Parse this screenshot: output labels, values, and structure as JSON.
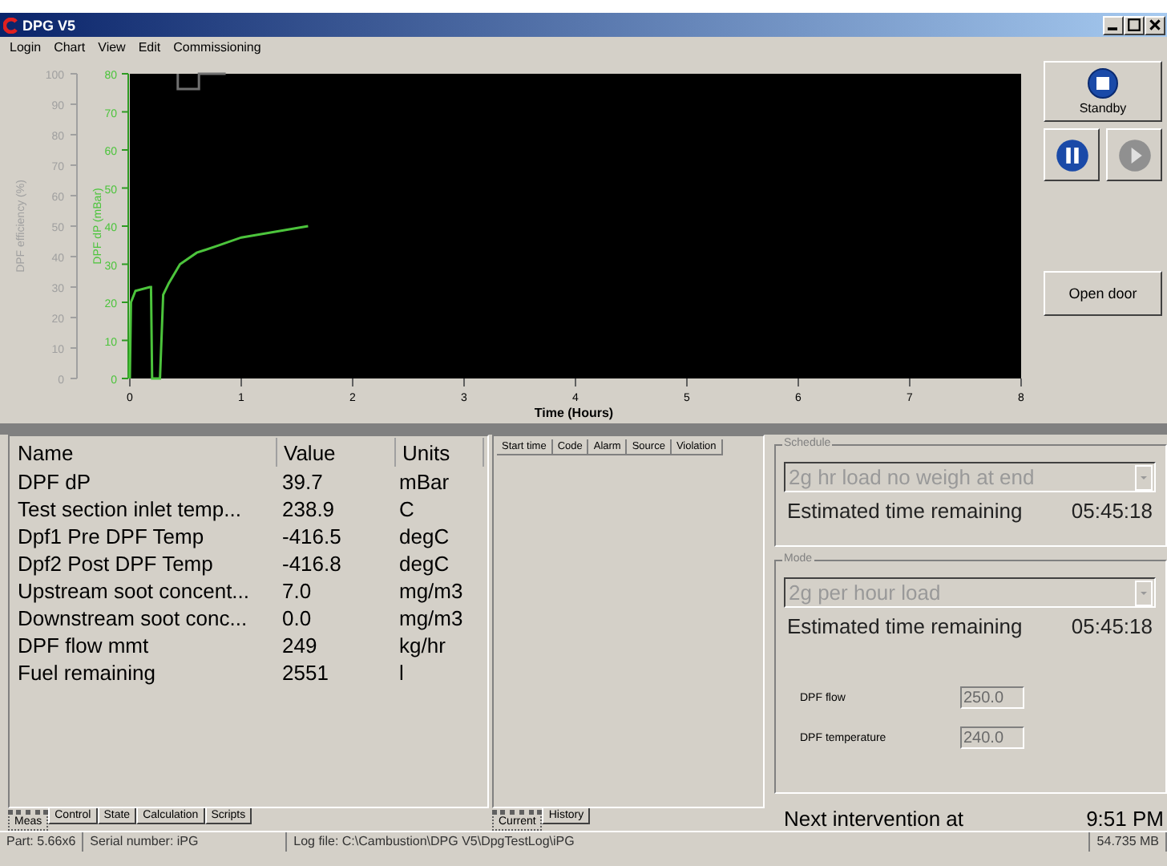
{
  "window": {
    "title": "DPG V5"
  },
  "menu": [
    "Login",
    "Chart",
    "View",
    "Edit",
    "Commissioning"
  ],
  "chart": {
    "chart_data": {
      "type": "line",
      "xlabel": "Time (Hours)",
      "ylabel": "DPF dP (mBar)",
      "y2label": "DPF efficiency (%)",
      "xlim": [
        0,
        8
      ],
      "ylim": [
        0,
        80
      ],
      "y2lim": [
        0,
        100
      ],
      "xticks": [
        0,
        1,
        2,
        3,
        4,
        5,
        6,
        7,
        8
      ],
      "yticks": [
        0,
        10,
        20,
        30,
        40,
        50,
        60,
        70,
        80
      ],
      "y2ticks": [
        0,
        10,
        20,
        30,
        40,
        50,
        60,
        70,
        80,
        90,
        100
      ],
      "series": [
        {
          "color": "#4cc43c",
          "axis": "y",
          "x": [
            0,
            0.01,
            0.05,
            0.18,
            0.19,
            0.2,
            0.27,
            0.3,
            0.35,
            0.45,
            0.6,
            0.8,
            1.0,
            1.2,
            1.4,
            1.6
          ],
          "values": [
            0,
            20,
            23,
            24,
            24,
            0,
            0,
            22,
            25,
            30,
            33,
            35,
            37,
            38,
            39,
            40
          ]
        },
        {
          "color": "#707070",
          "axis": "y2",
          "x": [
            0.43,
            0.43,
            0.62,
            0.62,
            0.86
          ],
          "values": [
            100,
            95,
            95,
            100,
            100
          ]
        }
      ]
    }
  },
  "controls": [
    {
      "kind": "stop",
      "label": "Standby",
      "disabled": false
    },
    {
      "kind": "pause",
      "disabled": false
    },
    {
      "kind": "play",
      "disabled": true
    },
    {
      "kind": "text",
      "label": "Open door",
      "disabled": false
    }
  ],
  "measurements": {
    "columns": [
      "Name",
      "Value",
      "Units"
    ],
    "rows": [
      [
        "DPF dP",
        "39.7",
        "mBar"
      ],
      [
        "Test section inlet temp...",
        "238.9",
        "C"
      ],
      [
        "Dpf1 Pre DPF  Temp",
        "-416.5",
        "degC"
      ],
      [
        "Dpf2 Post DPF Temp",
        "-416.8",
        "degC"
      ],
      [
        "Upstream soot concent...",
        "7.0",
        "mg/m3"
      ],
      [
        "Downstream soot conc...",
        "0.0",
        "mg/m3"
      ],
      [
        "DPF flow mmt",
        "249",
        "kg/hr"
      ],
      [
        "Fuel remaining",
        "2551",
        "l"
      ]
    ],
    "tabs": [
      {
        "label": "Meas",
        "selected": true
      },
      {
        "label": "Control",
        "selected": false
      },
      {
        "label": "State",
        "selected": false
      },
      {
        "label": "Calculation",
        "selected": false
      },
      {
        "label": "Scripts",
        "selected": false
      }
    ]
  },
  "alarms": {
    "columns": [
      "Start time",
      "Code",
      "Alarm",
      "Source",
      "Violation"
    ],
    "tabs": [
      {
        "label": "Current",
        "selected": true
      },
      {
        "label": "History",
        "selected": false
      }
    ]
  },
  "schedule": {
    "title": "Schedule",
    "value": "2g hr load no weigh at end",
    "disabled": true,
    "remaining_label": "Estimated time remaining",
    "remaining": "05:45:18"
  },
  "mode": {
    "title": "Mode",
    "value": "2g per hour load",
    "disabled": true,
    "remaining_label": "Estimated time remaining",
    "remaining": "05:45:18",
    "fields": [
      {
        "label": "DPF flow",
        "value": "250.0",
        "disabled": true
      },
      {
        "label": "DPF temperature",
        "value": "240.0",
        "disabled": true
      }
    ]
  },
  "next_intervention": {
    "label": "Next intervention at",
    "value": "9:51 PM"
  },
  "status_bar": [
    "Part:  5.66x6",
    "Serial number: iPG",
    "Log file:   C:\\Cambustion\\DPG V5\\DpgTestLog\\iPG",
    "54.735 MB"
  ]
}
